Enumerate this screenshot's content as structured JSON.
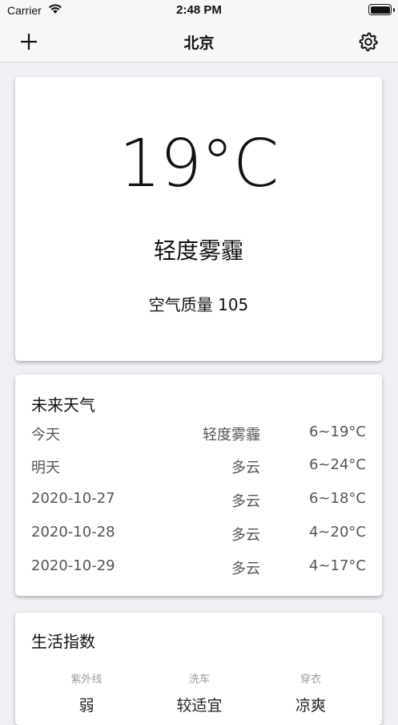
{
  "status_bar": {
    "carrier": "Carrier",
    "time": "2:48 PM"
  },
  "nav": {
    "title": "北京",
    "add_icon": "plus-icon",
    "settings_icon": "gear-icon"
  },
  "current": {
    "temperature": "19°C",
    "condition": "轻度雾霾",
    "air_quality": "空气质量 105"
  },
  "forecast": {
    "title": "未来天气",
    "rows": [
      {
        "date": "今天",
        "condition": "轻度雾霾",
        "temp": "6~19°C"
      },
      {
        "date": "明天",
        "condition": "多云",
        "temp": "6~24°C"
      },
      {
        "date": "2020-10-27",
        "condition": "多云",
        "temp": "6~18°C"
      },
      {
        "date": "2020-10-28",
        "condition": "多云",
        "temp": "4~20°C"
      },
      {
        "date": "2020-10-29",
        "condition": "多云",
        "temp": "4~17°C"
      }
    ]
  },
  "life_index": {
    "title": "生活指数",
    "items": [
      {
        "name": "紫外线",
        "value": "弱"
      },
      {
        "name": "洗车",
        "value": "较适宜"
      },
      {
        "name": "穿衣",
        "value": "凉爽"
      }
    ]
  }
}
